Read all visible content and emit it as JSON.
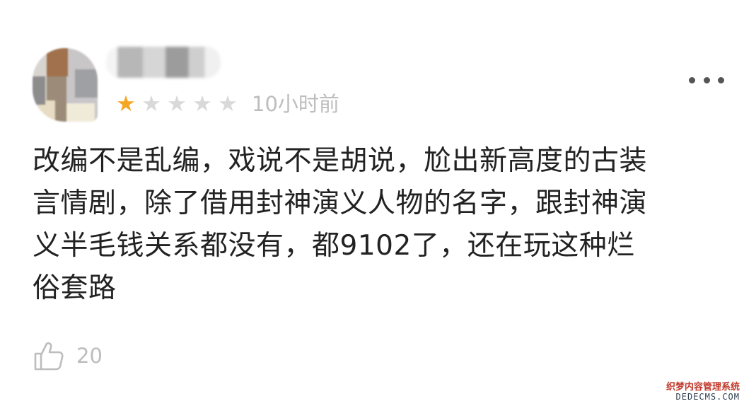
{
  "comment": {
    "rating": {
      "value": 1,
      "max": 5
    },
    "time": "10小时前",
    "text_lines": [
      "改编不是乱编，戏说不是胡说，尬出新高度的古装",
      "言情剧，除了借用封神演义人物的名字，跟封神演",
      "义半毛钱关系都没有，都9102了，还在玩这种烂",
      "俗套路"
    ],
    "likes": "20",
    "icons": {
      "more": "more-icon",
      "like": "thumbs-up-icon",
      "star": "star-icon"
    }
  },
  "colors": {
    "star_filled": "#f5a623",
    "star_empty": "#d9d9d9",
    "meta_text": "#bdbdbd",
    "body_text": "#222222"
  },
  "watermark": {
    "cn": "织梦内容管理系统",
    "en": "DEDECMS.COM"
  }
}
